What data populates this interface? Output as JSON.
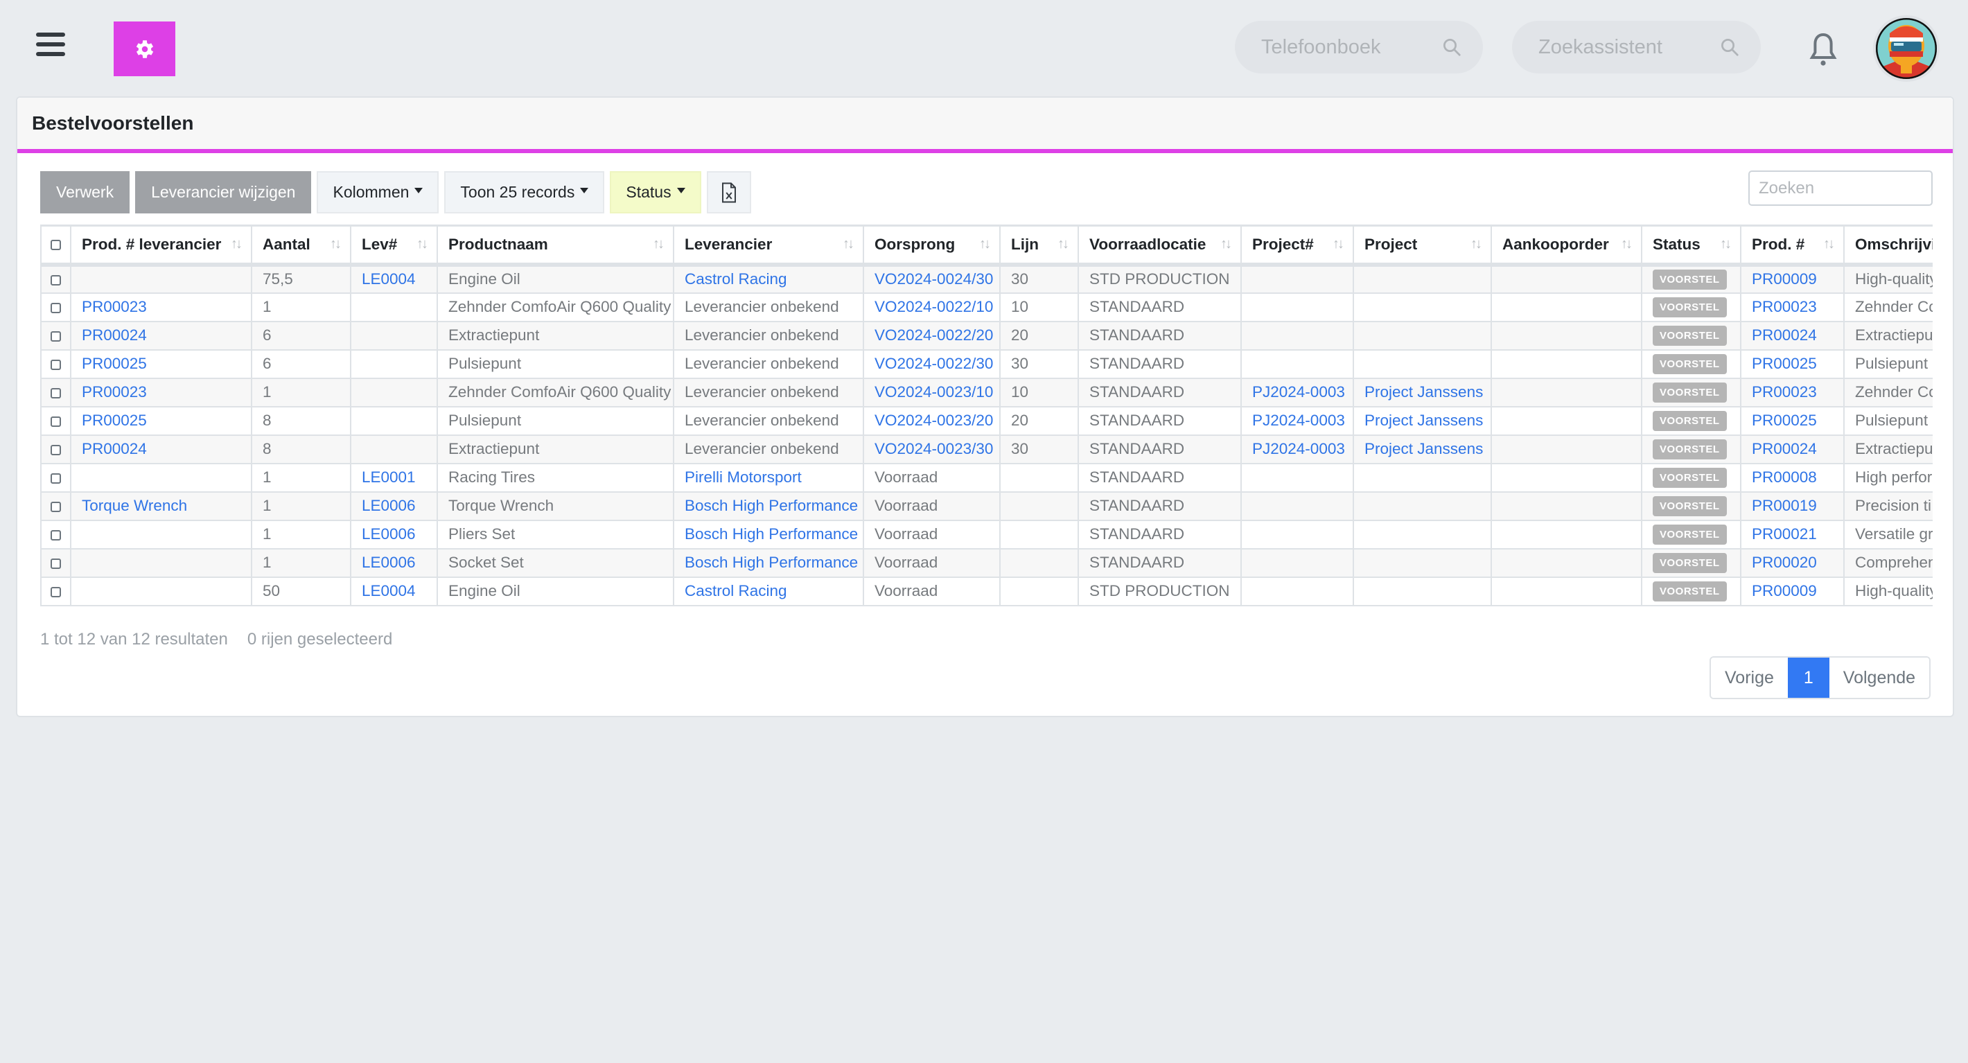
{
  "topbar": {
    "menu_icon": "hamburger-icon",
    "settings_icon": "gear-icon",
    "settings_color": "#dd40e6",
    "phonebook_placeholder": "Telefoonboek",
    "search_assistant_placeholder": "Zoekassistent",
    "notification_icon": "bell-icon",
    "avatar": "racing-helmet-avatar"
  },
  "card": {
    "title": "Bestelvoorstellen",
    "accent_color": "#dd40e6"
  },
  "toolbar": {
    "process_label": "Verwerk",
    "change_supplier_label": "Leverancier wijzigen",
    "columns_label": "Kolommen",
    "page_size_label": "Toon 25 records",
    "status_label": "Status",
    "export_icon": "excel-file-icon",
    "search_placeholder": "Zoeken"
  },
  "table": {
    "columns": [
      "Prod. # leverancier",
      "Aantal",
      "Lev#",
      "Productnaam",
      "Leverancier",
      "Oorsprong",
      "Lijn",
      "Voorraadlocatie",
      "Project#",
      "Project",
      "Aankooporder",
      "Status",
      "Prod. #",
      "Omschrijving"
    ],
    "rows": [
      {
        "prod_lev": "",
        "aantal": "75,5",
        "lev": "LE0004",
        "productnaam": "Engine Oil",
        "leverancier": "Castrol Racing",
        "leverancier_link": true,
        "oorsprong": "VO2024-0024/30",
        "lijn": "30",
        "locatie": "STD PRODUCTION",
        "project_nr": "",
        "project": "",
        "aankooporder": "",
        "status": "VOORSTEL",
        "prod": "PR00009",
        "omschrijving": "High-quality"
      },
      {
        "prod_lev": "PR00023",
        "aantal": "1",
        "lev": "",
        "productnaam": "Zehnder ComfoAir Q600 Quality",
        "leverancier": "Leverancier onbekend",
        "leverancier_link": false,
        "oorsprong": "VO2024-0022/10",
        "lijn": "10",
        "locatie": "STANDAARD",
        "project_nr": "",
        "project": "",
        "aankooporder": "",
        "status": "VOORSTEL",
        "prod": "PR00023",
        "omschrijving": "Zehnder Co"
      },
      {
        "prod_lev": "PR00024",
        "aantal": "6",
        "lev": "",
        "productnaam": "Extractiepunt",
        "leverancier": "Leverancier onbekend",
        "leverancier_link": false,
        "oorsprong": "VO2024-0022/20",
        "lijn": "20",
        "locatie": "STANDAARD",
        "project_nr": "",
        "project": "",
        "aankooporder": "",
        "status": "VOORSTEL",
        "prod": "PR00024",
        "omschrijving": "Extractiepu"
      },
      {
        "prod_lev": "PR00025",
        "aantal": "6",
        "lev": "",
        "productnaam": "Pulsiepunt",
        "leverancier": "Leverancier onbekend",
        "leverancier_link": false,
        "oorsprong": "VO2024-0022/30",
        "lijn": "30",
        "locatie": "STANDAARD",
        "project_nr": "",
        "project": "",
        "aankooporder": "",
        "status": "VOORSTEL",
        "prod": "PR00025",
        "omschrijving": "Pulsiepunt"
      },
      {
        "prod_lev": "PR00023",
        "aantal": "1",
        "lev": "",
        "productnaam": "Zehnder ComfoAir Q600 Quality",
        "leverancier": "Leverancier onbekend",
        "leverancier_link": false,
        "oorsprong": "VO2024-0023/10",
        "lijn": "10",
        "locatie": "STANDAARD",
        "project_nr": "PJ2024-0003",
        "project": "Project Janssens",
        "aankooporder": "",
        "status": "VOORSTEL",
        "prod": "PR00023",
        "omschrijving": "Zehnder Co"
      },
      {
        "prod_lev": "PR00025",
        "aantal": "8",
        "lev": "",
        "productnaam": "Pulsiepunt",
        "leverancier": "Leverancier onbekend",
        "leverancier_link": false,
        "oorsprong": "VO2024-0023/20",
        "lijn": "20",
        "locatie": "STANDAARD",
        "project_nr": "PJ2024-0003",
        "project": "Project Janssens",
        "aankooporder": "",
        "status": "VOORSTEL",
        "prod": "PR00025",
        "omschrijving": "Pulsiepunt"
      },
      {
        "prod_lev": "PR00024",
        "aantal": "8",
        "lev": "",
        "productnaam": "Extractiepunt",
        "leverancier": "Leverancier onbekend",
        "leverancier_link": false,
        "oorsprong": "VO2024-0023/30",
        "lijn": "30",
        "locatie": "STANDAARD",
        "project_nr": "PJ2024-0003",
        "project": "Project Janssens",
        "aankooporder": "",
        "status": "VOORSTEL",
        "prod": "PR00024",
        "omschrijving": "Extractiepu"
      },
      {
        "prod_lev": "",
        "aantal": "1",
        "lev": "LE0001",
        "productnaam": "Racing Tires",
        "leverancier": "Pirelli Motorsport",
        "leverancier_link": true,
        "oorsprong": "Voorraad",
        "lijn": "",
        "locatie": "STANDAARD",
        "project_nr": "",
        "project": "",
        "aankooporder": "",
        "status": "VOORSTEL",
        "prod": "PR00008",
        "omschrijving": "High perfor"
      },
      {
        "prod_lev": "Torque Wrench",
        "aantal": "1",
        "lev": "LE0006",
        "productnaam": "Torque Wrench",
        "leverancier": "Bosch High Performance",
        "leverancier_link": true,
        "oorsprong": "Voorraad",
        "lijn": "",
        "locatie": "STANDAARD",
        "project_nr": "",
        "project": "",
        "aankooporder": "",
        "status": "VOORSTEL",
        "prod": "PR00019",
        "omschrijving": "Precision ti"
      },
      {
        "prod_lev": "",
        "aantal": "1",
        "lev": "LE0006",
        "productnaam": "Pliers Set",
        "leverancier": "Bosch High Performance",
        "leverancier_link": true,
        "oorsprong": "Voorraad",
        "lijn": "",
        "locatie": "STANDAARD",
        "project_nr": "",
        "project": "",
        "aankooporder": "",
        "status": "VOORSTEL",
        "prod": "PR00021",
        "omschrijving": "Versatile gr"
      },
      {
        "prod_lev": "",
        "aantal": "1",
        "lev": "LE0006",
        "productnaam": "Socket Set",
        "leverancier": "Bosch High Performance",
        "leverancier_link": true,
        "oorsprong": "Voorraad",
        "lijn": "",
        "locatie": "STANDAARD",
        "project_nr": "",
        "project": "",
        "aankooporder": "",
        "status": "VOORSTEL",
        "prod": "PR00020",
        "omschrijving": "Comprehen"
      },
      {
        "prod_lev": "",
        "aantal": "50",
        "lev": "LE0004",
        "productnaam": "Engine Oil",
        "leverancier": "Castrol Racing",
        "leverancier_link": true,
        "oorsprong": "Voorraad",
        "lijn": "",
        "locatie": "STD PRODUCTION",
        "project_nr": "",
        "project": "",
        "aankooporder": "",
        "status": "VOORSTEL",
        "prod": "PR00009",
        "omschrijving": "High-quality"
      }
    ]
  },
  "footer": {
    "results_text": "1 tot 12 van 12 resultaten",
    "selected_text": "0 rijen geselecteerd",
    "prev_label": "Vorige",
    "current_page": "1",
    "next_label": "Volgende",
    "active_color": "#3279f3"
  }
}
